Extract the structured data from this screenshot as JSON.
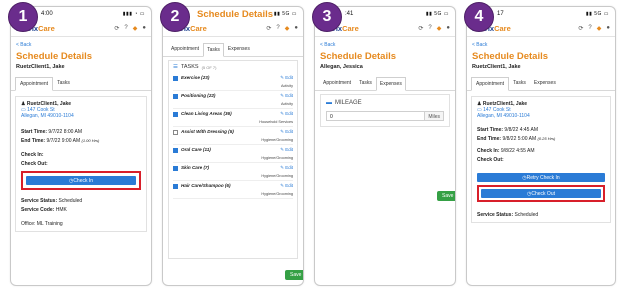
{
  "badges": [
    "1",
    "2",
    "3",
    "4"
  ],
  "app": {
    "logo_a": "Matrix",
    "logo_b": "Care",
    "back": "< Back",
    "title": "Schedule Details"
  },
  "tabs": {
    "appointment": "Appointment",
    "tasks": "Tasks",
    "expenses": "Expenses"
  },
  "p1": {
    "time": "4:00",
    "client_header": "RuetzClient1, Jake",
    "name": "RuetzClient1, Jake",
    "addr1": "147 Cook St",
    "addr2": "Allegan, MI 49010-1104",
    "start_label": "Start Time:",
    "start_value": "9/7/22 8:00 AM",
    "end_label": "End Time:",
    "end_value": "9/7/22 9:00 AM",
    "end_dur": "(1.00 Hrs)",
    "checkin_label": "Check In:",
    "checkout_label": "Check Out:",
    "checkin_btn": "Check In",
    "status_label": "Service Status:",
    "status_value": "Scheduled",
    "code_label": "Service Code:",
    "code_value": "HMK",
    "office": "Office: ML Training"
  },
  "p2": {
    "tasks_header": "TASKS",
    "tasks_count": "(5 OF 7)",
    "edit": "Edit",
    "items": [
      {
        "name": "Exercise (23)",
        "cat": "Activity",
        "checked": true
      },
      {
        "name": "Positioning (22)",
        "cat": "Activity",
        "checked": true
      },
      {
        "name": "Clean Living Areas (36)",
        "cat": "Household Services",
        "checked": true
      },
      {
        "name": "Assist With Dressing (5)",
        "cat": "Hygiene/Grooming",
        "checked": false
      },
      {
        "name": "Oral Care (11)",
        "cat": "Hygiene/Grooming",
        "checked": true
      },
      {
        "name": "Skin Care (7)",
        "cat": "Hygiene/Grooming",
        "checked": true
      },
      {
        "name": "Hair Care/Shampoo (6)",
        "cat": "Hygiene/Grooming",
        "checked": true
      }
    ],
    "save": "Save"
  },
  "p3": {
    "time": ":41",
    "client": "Allegan, Jessica",
    "mileage": "MILEAGE",
    "value": "0",
    "unit": "Miles",
    "save": "Save"
  },
  "p4": {
    "time": "17",
    "client_header": "RuetzClient1, Jake",
    "name": "RuetzClient1, Jake",
    "addr1": "147 Cook St",
    "addr2": "Allegan, MI 49010-1104",
    "start_label": "Start Time:",
    "start_value": "9/8/22 4:45 AM",
    "end_label": "End Time:",
    "end_value": "9/8/22 5:00 AM",
    "end_dur": "(0.25 Hrs)",
    "checkin_label": "Check In:",
    "checkin_value": "9/8/22 4:55 AM",
    "checkout_label": "Check Out:",
    "retry_btn": "Retry Check In",
    "checkout_btn": "Check Out",
    "status_label": "Service Status:",
    "status_value": "Scheduled"
  },
  "colors": {
    "accent": "#e68a1f",
    "link": "#2a7bd6",
    "badge": "#6a2c8c",
    "highlight": "#d81f2a",
    "save": "#35a045"
  }
}
